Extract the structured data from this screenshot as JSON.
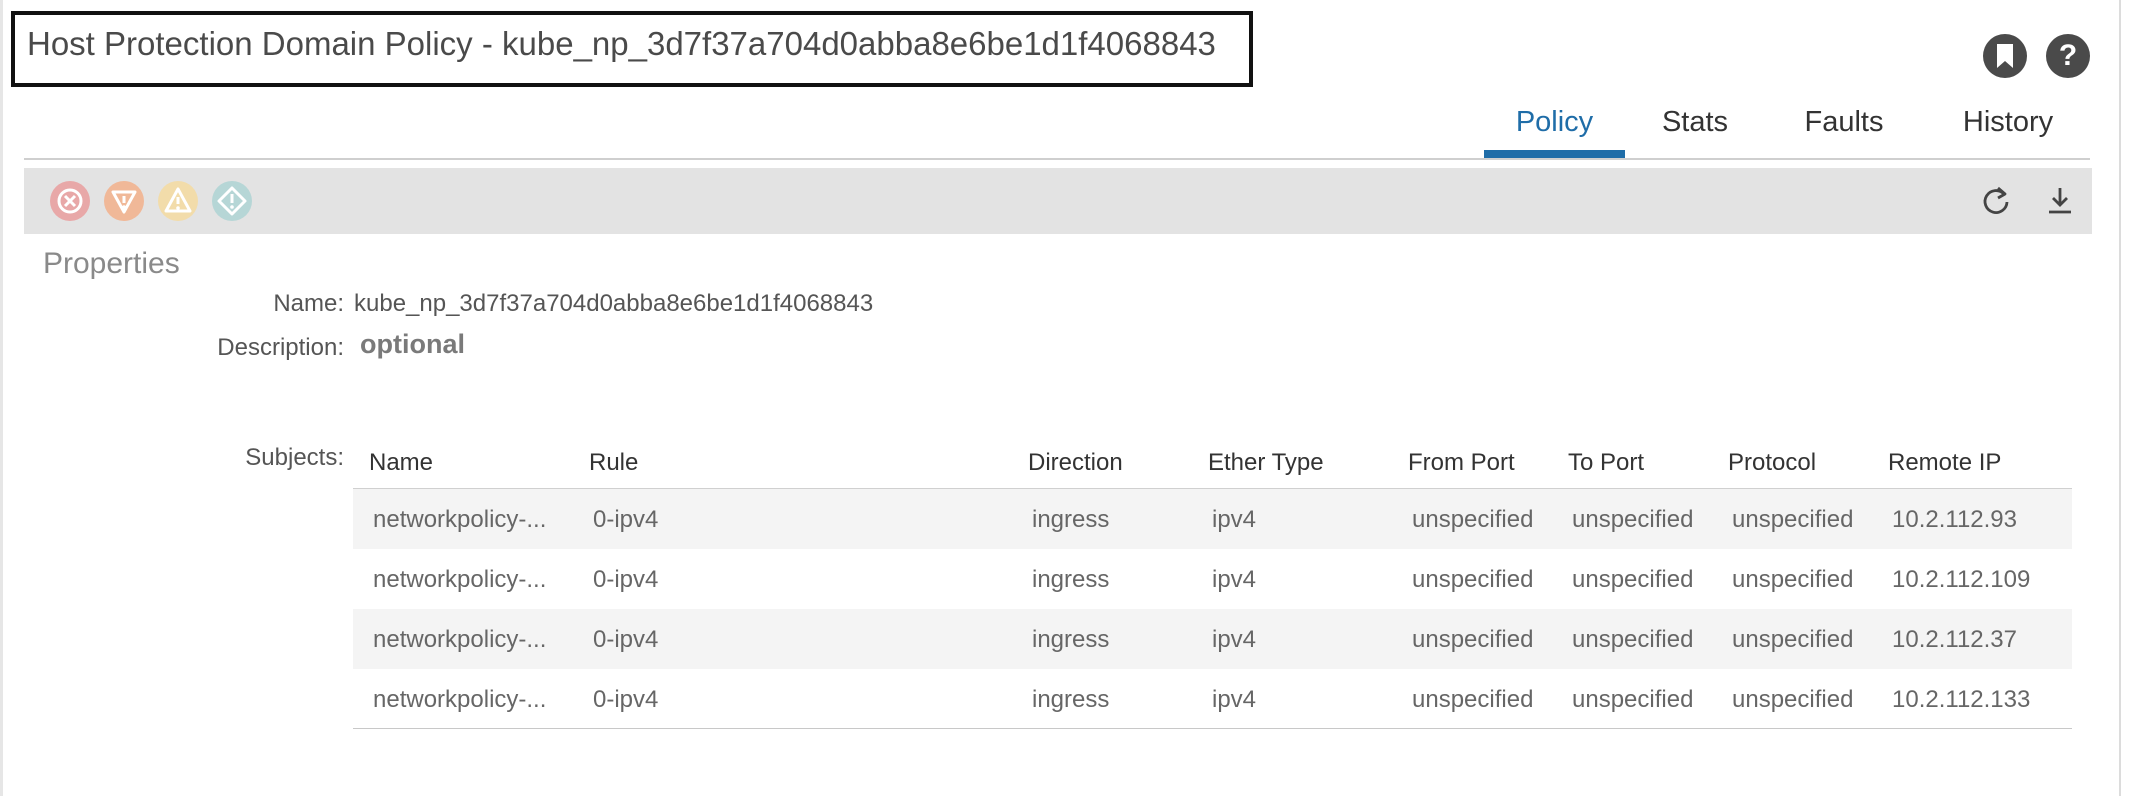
{
  "header": {
    "title": "Host Protection Domain Policy - kube_np_3d7f37a704d0abba8e6be1d1f4068843",
    "help_glyph": "?"
  },
  "icons": {
    "bookmark": "bookmark-icon",
    "help": "help-icon",
    "refresh": "refresh-icon",
    "download": "download-icon",
    "faults": [
      "critical-fault-icon",
      "major-fault-icon",
      "minor-fault-icon",
      "warning-fault-icon"
    ]
  },
  "tabs": [
    {
      "label": "Policy",
      "active": true
    },
    {
      "label": "Stats",
      "active": false
    },
    {
      "label": "Faults",
      "active": false
    },
    {
      "label": "History",
      "active": false
    }
  ],
  "fault_colors": {
    "critical": "#e8a8a8",
    "major": "#f0b898",
    "minor": "#f2dcaa",
    "warning": "#b6d6d6"
  },
  "accent_color": "#1f6da8",
  "properties": {
    "section_title": "Properties",
    "name_label": "Name:",
    "name_value": "kube_np_3d7f37a704d0abba8e6be1d1f4068843",
    "description_label": "Description:",
    "description_value": "optional",
    "subjects_label": "Subjects:"
  },
  "subjects_table": {
    "columns": [
      "Name",
      "Rule",
      "Direction",
      "Ether Type",
      "From Port",
      "To Port",
      "Protocol",
      "Remote IP"
    ],
    "rows": [
      [
        "networkpolicy-...",
        "0-ipv4",
        "ingress",
        "ipv4",
        "unspecified",
        "unspecified",
        "unspecified",
        "10.2.112.93"
      ],
      [
        "networkpolicy-...",
        "0-ipv4",
        "ingress",
        "ipv4",
        "unspecified",
        "unspecified",
        "unspecified",
        "10.2.112.109"
      ],
      [
        "networkpolicy-...",
        "0-ipv4",
        "ingress",
        "ipv4",
        "unspecified",
        "unspecified",
        "unspecified",
        "10.2.112.37"
      ],
      [
        "networkpolicy-...",
        "0-ipv4",
        "ingress",
        "ipv4",
        "unspecified",
        "unspecified",
        "unspecified",
        "10.2.112.133"
      ]
    ]
  }
}
